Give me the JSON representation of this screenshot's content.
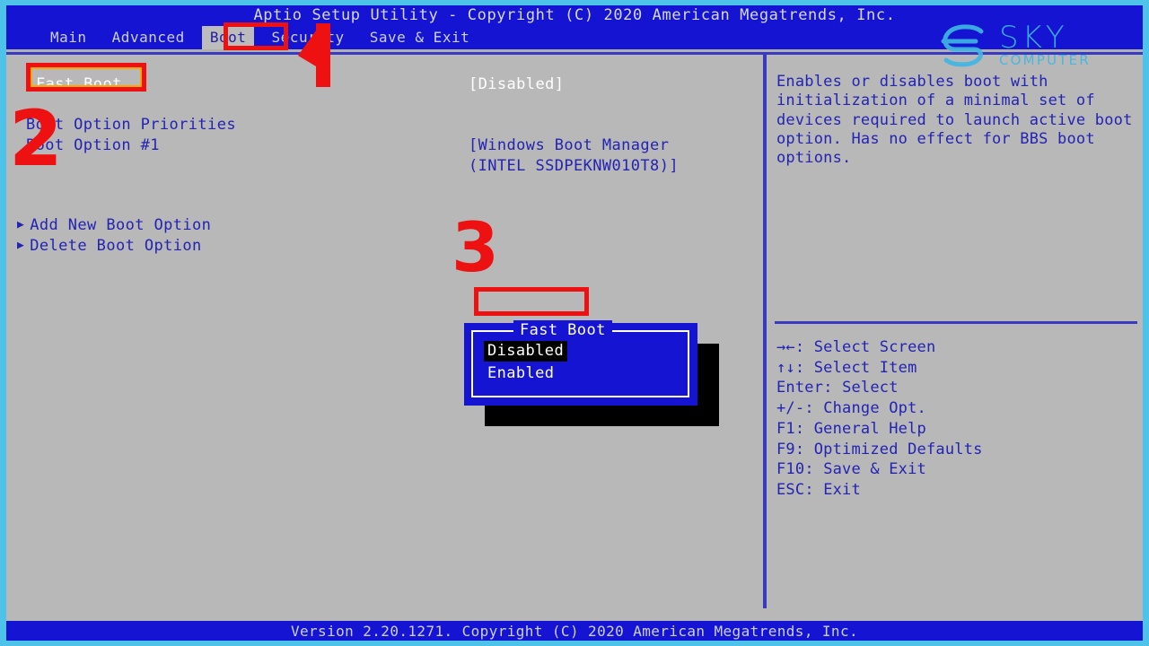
{
  "window": {
    "title": "Aptio Setup Utility - Copyright (C) 2020 American Megatrends, Inc.",
    "footer": "Version 2.20.1271. Copyright (C) 2020 American Megatrends, Inc."
  },
  "menubar": {
    "items": [
      {
        "label": "Main",
        "active": false
      },
      {
        "label": "Advanced",
        "active": false
      },
      {
        "label": "Boot",
        "active": true
      },
      {
        "label": "Security",
        "active": false
      },
      {
        "label": "Save & Exit",
        "active": false
      }
    ]
  },
  "settings": {
    "rows": [
      {
        "label": "Fast Boot",
        "value": "[Disabled]",
        "selected": true,
        "arrow": false
      },
      {
        "label": "Boot Option Priorities",
        "value": "",
        "selected": false,
        "arrow": false
      },
      {
        "label": "Boot Option #1",
        "value": "[Windows Boot Manager",
        "selected": false,
        "arrow": false
      },
      {
        "label": "",
        "value": "(INTEL SSDPEKNW010T8)]",
        "selected": false,
        "arrow": false
      },
      {
        "label": "Add New Boot Option",
        "value": "",
        "selected": false,
        "arrow": true
      },
      {
        "label": "Delete Boot Option",
        "value": "",
        "selected": false,
        "arrow": true
      }
    ]
  },
  "help": {
    "description": "Enables or disables boot with initialization of a minimal set of devices required to launch active boot option. Has no effect for BBS boot options.",
    "keys": [
      {
        "key": "→←",
        "sep": ": ",
        "action": "Select Screen"
      },
      {
        "key": "↑↓",
        "sep": ": ",
        "action": "Select Item"
      },
      {
        "key": "Enter",
        "sep": ": ",
        "action": "Select"
      },
      {
        "key": "+/-",
        "sep": ": ",
        "action": "Change Opt."
      },
      {
        "key": "F1",
        "sep": ": ",
        "action": "General Help"
      },
      {
        "key": "F9",
        "sep": ": ",
        "action": "Optimized Defaults"
      },
      {
        "key": "F10",
        "sep": ": ",
        "action": "Save & Exit"
      },
      {
        "key": "ESC",
        "sep": ": ",
        "action": "Exit"
      }
    ]
  },
  "popup": {
    "title": "Fast Boot",
    "options": [
      {
        "label": "Disabled",
        "selected": true
      },
      {
        "label": "Enabled",
        "selected": false
      }
    ]
  },
  "annotations": {
    "step1": "1",
    "step2": "2",
    "step3": "3"
  },
  "watermark": {
    "line1": "SKY",
    "line2": "COMPUTER"
  },
  "colors": {
    "bios_blue": "#1414d2",
    "text_blue": "#2323b4",
    "screen_gray": "#b8b8b8",
    "frame_cyan": "#4ec3ea",
    "annotation_red": "#ee1111",
    "annotation_orange": "#ffa500",
    "watermark_cyan": "#3fb6e3"
  }
}
